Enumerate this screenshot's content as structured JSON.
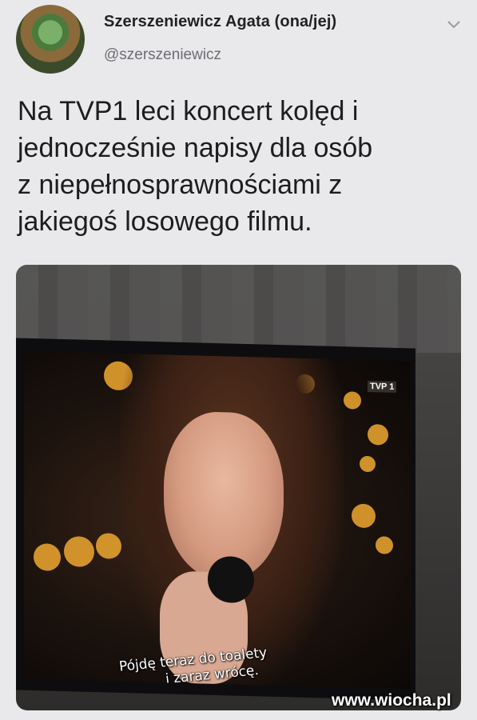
{
  "author": {
    "name": "Szerszeniewicz Agata (ona/jej)",
    "handle": "@szerszeniewicz"
  },
  "tweet": {
    "text": "Na TVP1 leci koncert kolęd i\njednocześnie napisy dla osób\nz niepełnosprawnościami z\njakiegoś losowego filmu."
  },
  "media": {
    "channel_logo": "TVP 1",
    "subtitle_line1": "Pójdę teraz do toalety",
    "subtitle_line2": "i zaraz wrócę."
  },
  "watermark": "www.wiocha.pl",
  "icons": {
    "more": "chevron-down-icon"
  },
  "colors": {
    "background": "#e9e9ec",
    "handle": "#6d6d72",
    "bokeh": "#f0a830"
  }
}
